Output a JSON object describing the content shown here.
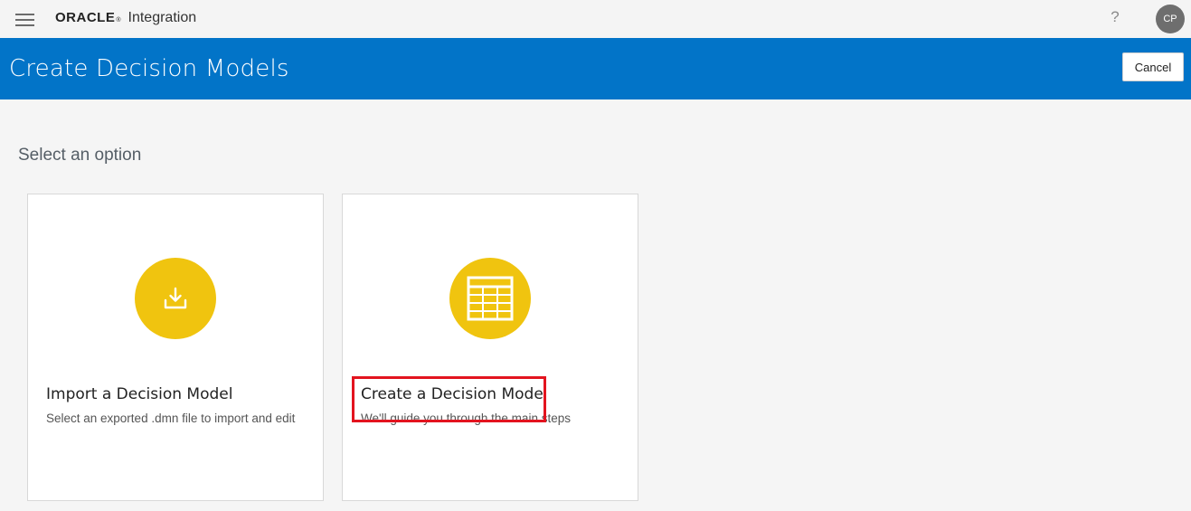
{
  "topbar": {
    "brand_name": "ORACLE",
    "brand_mark": "®",
    "product_name": "Integration",
    "help_label": "?",
    "avatar_initials": "CP",
    "menu_icon": "hamburger-icon"
  },
  "header": {
    "title": "Create Decision Models",
    "cancel_label": "Cancel",
    "background_color": "#0274c8"
  },
  "main": {
    "heading": "Select an option",
    "cards": [
      {
        "icon": "download-icon",
        "title": "Import a Decision Model",
        "description": "Select an exported .dmn file to import and edit"
      },
      {
        "icon": "table-icon",
        "title": "Create a Decision Model",
        "description": "We'll guide you through the main steps"
      }
    ],
    "accent_color": "#f0c40f",
    "highlight_color": "#e3141f"
  }
}
